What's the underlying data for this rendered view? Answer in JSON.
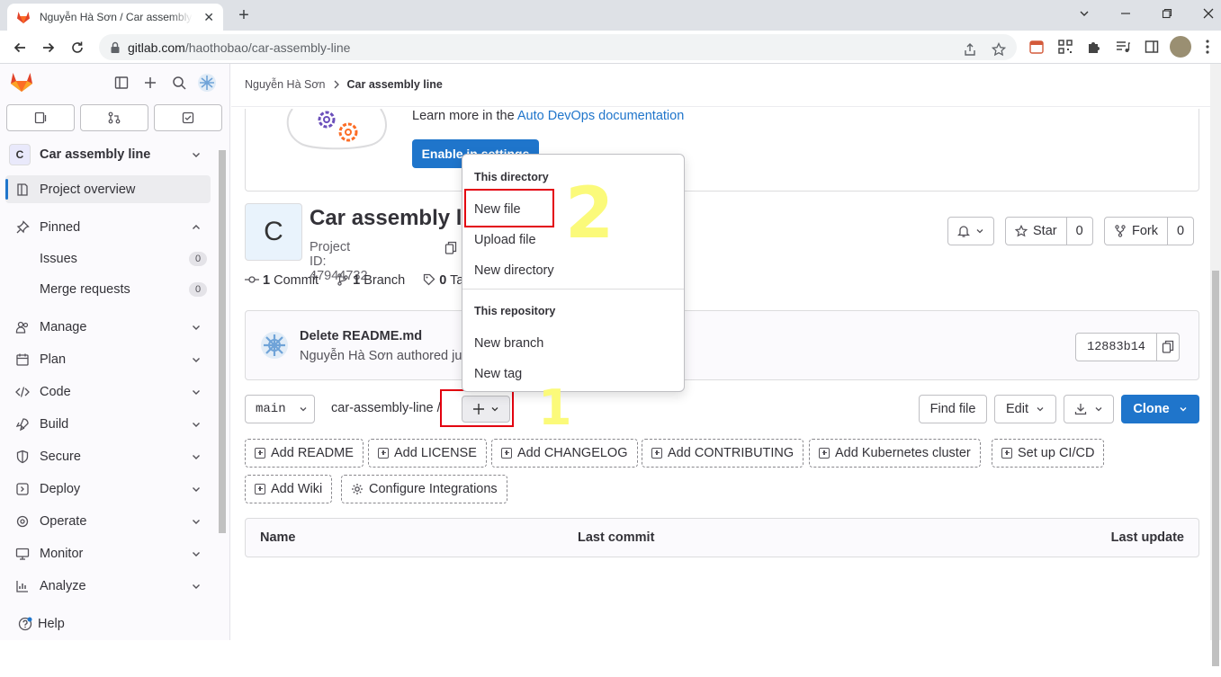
{
  "browser": {
    "tab_title": "Nguyễn Hà Sơn / Car assembly line · GitLab",
    "url_host": "gitlab.com",
    "url_path": "/haothobao/car-assembly-line"
  },
  "sidebar": {
    "project_initial": "C",
    "project_name": "Car assembly line",
    "items": {
      "overview": "Project overview",
      "pinned": "Pinned",
      "issues": "Issues",
      "issues_count": "0",
      "merge_requests": "Merge requests",
      "merge_requests_count": "0",
      "manage": "Manage",
      "plan": "Plan",
      "code": "Code",
      "build": "Build",
      "secure": "Secure",
      "deploy": "Deploy",
      "operate": "Operate",
      "monitor": "Monitor",
      "analyze": "Analyze"
    },
    "help": "Help"
  },
  "breadcrumb": {
    "user": "Nguyễn Hà Sơn",
    "project": "Car assembly line"
  },
  "devops": {
    "text": "Learn more in the ",
    "link": "Auto DevOps documentation",
    "button": "Enable in settings"
  },
  "project": {
    "initial": "C",
    "title": "Car assembly line",
    "id_label": "Project ID: 47944732",
    "star_label": "Star",
    "star_count": "0",
    "fork_label": "Fork",
    "fork_count": "0"
  },
  "stats": {
    "commits_n": "1",
    "commits_label": "Commit",
    "branches_n": "1",
    "branches_label": "Branch",
    "tags_n": "0",
    "tags_label": "Tags"
  },
  "last_commit": {
    "message": "Delete README.md",
    "author": "Nguyễn Hà Sơn",
    "authored": "authored just now",
    "sha": "12883b14"
  },
  "repo": {
    "branch": "main",
    "path": "car-assembly-line",
    "slash": "/",
    "find_file": "Find file",
    "edit": "Edit",
    "clone": "Clone"
  },
  "add_buttons": [
    "Add README",
    "Add LICENSE",
    "Add CHANGELOG",
    "Add CONTRIBUTING",
    "Add Kubernetes cluster",
    "Set up CI/CD",
    "Add Wiki",
    "Configure Integrations"
  ],
  "table": {
    "name": "Name",
    "last_commit": "Last commit",
    "last_update": "Last update"
  },
  "dropdown": {
    "dir_header": "This directory",
    "new_file": "New file",
    "upload_file": "Upload file",
    "new_directory": "New directory",
    "repo_header": "This repository",
    "new_branch": "New branch",
    "new_tag": "New tag"
  },
  "annotations": {
    "step1": "1",
    "step2": "2"
  },
  "colors": {
    "accent": "#1f75cb",
    "highlight": "#e3000f",
    "annotation": "#fbfa7a"
  }
}
